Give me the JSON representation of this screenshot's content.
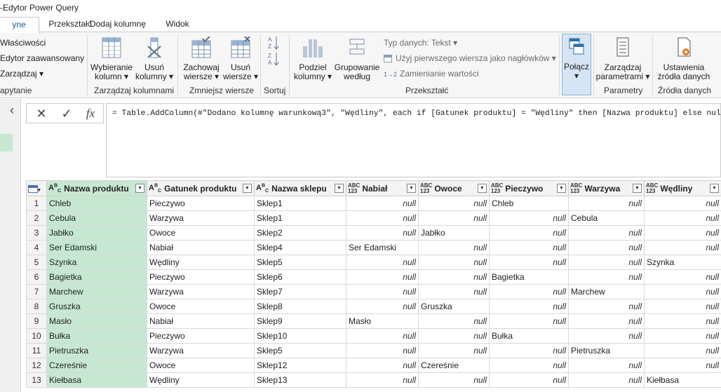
{
  "window": {
    "title": "-Edytor Power Query"
  },
  "tabs": [
    {
      "label": "yne",
      "active": true
    },
    {
      "label": "Przekształć",
      "active": false
    },
    {
      "label": "Dodaj kolumnę",
      "active": false
    },
    {
      "label": "Widok",
      "active": false
    }
  ],
  "ribbon": {
    "query_group": {
      "items": [
        "Właściwości",
        "Edytor zaawansowany",
        "Zarządzaj ▾"
      ],
      "label": "apytanie"
    },
    "manage_columns": {
      "choose": "Wybieranie\nkolumn ▾",
      "remove": "Usuń\nkolumny ▾",
      "label": "Zarządzaj kolumnami"
    },
    "reduce_rows": {
      "keep": "Zachowaj\nwiersze ▾",
      "remove": "Usuń\nwiersze ▾",
      "label": "Zmniejsz wiersze"
    },
    "sort": {
      "label": "Sortuj"
    },
    "transform": {
      "split": "Podziel\nkolumny ▾",
      "group": "Grupowanie\nwedług",
      "datatype": "Typ danych: Tekst ▾",
      "first_row": "Użyj pierwszego wiersza jako nagłówków ▾",
      "replace": "Zamienianie wartości",
      "label": "Przekształć"
    },
    "combine": {
      "btn": "Połącz\n▾"
    },
    "parameters": {
      "btn": "Zarządzaj\nparametrami ▾",
      "label": "Parametry"
    },
    "datasources": {
      "btn": "Ustawienia\nźródła danych",
      "label": "Źródła danych"
    }
  },
  "formula_bar": {
    "cancel_icon": "✕",
    "commit_icon": "✓",
    "fx": "fx",
    "formula": "= Table.AddColumn(#\"Dodano kolumnę warunkową3\", \"Wędliny\", each if [Gatunek produktu] = \"Wędliny\" then [Nazwa produktu] else null)"
  },
  "grid": {
    "columns": [
      {
        "name": "Nazwa produktu",
        "type": "ABC"
      },
      {
        "name": "Gatunek produktu",
        "type": "ABC"
      },
      {
        "name": "Nazwa sklepu",
        "type": "ABC"
      },
      {
        "name": "Nabiał",
        "type": "ABC123"
      },
      {
        "name": "Owoce",
        "type": "ABC123"
      },
      {
        "name": "Pieczywo",
        "type": "ABC123"
      },
      {
        "name": "Warzywa",
        "type": "ABC123"
      },
      {
        "name": "Wędliny",
        "type": "ABC123"
      }
    ],
    "rows": [
      [
        "1",
        "Chleb",
        "Pieczywo",
        "Sklep1",
        "null",
        "null",
        "Chleb",
        "null",
        "null"
      ],
      [
        "2",
        "Cebula",
        "Warzywa",
        "Sklep1",
        "null",
        "null",
        "null",
        "Cebula",
        "null"
      ],
      [
        "3",
        "Jabłko",
        "Owoce",
        "Sklep2",
        "null",
        "Jabłko",
        "null",
        "null",
        "null"
      ],
      [
        "4",
        "Ser Edamski",
        "Nabiał",
        "Sklep4",
        "Ser Edamski",
        "null",
        "null",
        "null",
        "null"
      ],
      [
        "5",
        "Szynka",
        "Wędliny",
        "Sklep5",
        "null",
        "null",
        "null",
        "null",
        "Szynka"
      ],
      [
        "6",
        "Bagietka",
        "Pieczywo",
        "Sklep6",
        "null",
        "null",
        "Bagietka",
        "null",
        "null"
      ],
      [
        "7",
        "Marchew",
        "Warzywa",
        "Sklep7",
        "null",
        "null",
        "null",
        "Marchew",
        "null"
      ],
      [
        "8",
        "Gruszka",
        "Owoce",
        "Sklep8",
        "null",
        "Gruszka",
        "null",
        "null",
        "null"
      ],
      [
        "9",
        "Masło",
        "Nabiał",
        "Sklep9",
        "Masło",
        "null",
        "null",
        "null",
        "null"
      ],
      [
        "10",
        "Bułka",
        "Pieczywo",
        "Sklep10",
        "null",
        "null",
        "Bułka",
        "null",
        "null"
      ],
      [
        "11",
        "Pietruszka",
        "Warzywa",
        "Sklep5",
        "null",
        "null",
        "null",
        "Pietruszka",
        "null"
      ],
      [
        "12",
        "Czereśnie",
        "Owoce",
        "Sklep12",
        "null",
        "Czereśnie",
        "null",
        "null",
        "null"
      ],
      [
        "13",
        "Kiełbasa",
        "Wędliny",
        "Sklep13",
        "null",
        "null",
        "null",
        "null",
        "Kiełbasa"
      ]
    ]
  },
  "colors": {
    "selected_column": "#c6e8d2",
    "accent": "#1e5a9e"
  }
}
